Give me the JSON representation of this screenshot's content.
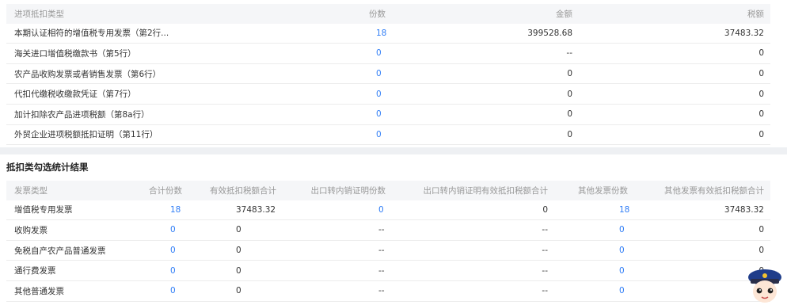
{
  "table1": {
    "headers": [
      "进项抵扣类型",
      "份数",
      "金额",
      "税额"
    ],
    "rows": [
      [
        "本期认证相符的增值税专用发票（第2行...",
        "18",
        "399528.68",
        "37483.32"
      ],
      [
        "海关进口增值税缴款书（第5行）",
        "0",
        "--",
        "0"
      ],
      [
        "农产品收购发票或者销售发票（第6行）",
        "0",
        "0",
        "0"
      ],
      [
        "代扣代缴税收缴款凭证（第7行）",
        "0",
        "0",
        "0"
      ],
      [
        "加计扣除农产品进项税额（第8a行）",
        "0",
        "0",
        "0"
      ],
      [
        "外贸企业进项税额抵扣证明（第11行）",
        "0",
        "0",
        "0"
      ]
    ]
  },
  "section2_title": "抵扣类勾选统计结果",
  "table2": {
    "headers": [
      "发票类型",
      "合计份数",
      "有效抵扣税额合计",
      "出口转内销证明份数",
      "出口转内销证明有效抵扣税额合计",
      "其他发票份数",
      "其他发票有效抵扣税额合计"
    ],
    "rows": [
      [
        "增值税专用发票",
        "18",
        "37483.32",
        "0",
        "0",
        "18",
        "37483.32"
      ],
      [
        "收购发票",
        "0",
        "0",
        "--",
        "--",
        "0",
        "0"
      ],
      [
        "免税自产农产品普通发票",
        "0",
        "0",
        "--",
        "--",
        "0",
        "0"
      ],
      [
        "通行费发票",
        "0",
        "0",
        "--",
        "--",
        "0",
        "0"
      ],
      [
        "其他普通发票",
        "0",
        "0",
        "--",
        "--",
        "0",
        "0"
      ]
    ]
  },
  "colors": {
    "link": "#2f7df6",
    "header_bg": "#f5f6f8",
    "band": "#eef0f3"
  },
  "icons": {
    "assistant": "tax-officer-avatar-icon"
  }
}
